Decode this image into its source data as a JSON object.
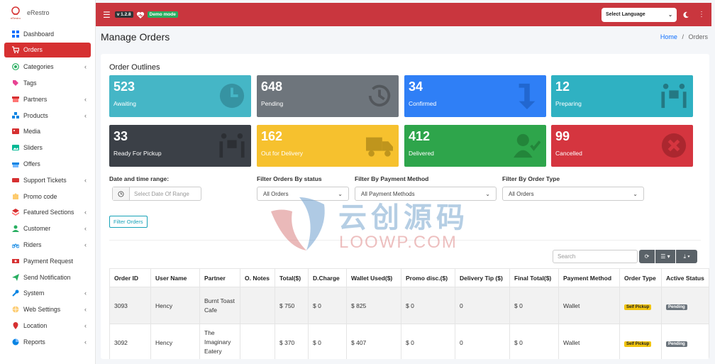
{
  "brand": {
    "name": "eRestro",
    "logo_text": "eRestro"
  },
  "sidebar": {
    "items": [
      {
        "label": "Dashboard",
        "icon": "grid-icon"
      },
      {
        "label": "Orders",
        "icon": "cart-icon",
        "active": true
      },
      {
        "label": "Categories",
        "icon": "target-icon",
        "has_children": true
      },
      {
        "label": "Tags",
        "icon": "tag-icon"
      },
      {
        "label": "Partners",
        "icon": "store-icon",
        "has_children": true
      },
      {
        "label": "Products",
        "icon": "cubes-icon",
        "has_children": true
      },
      {
        "label": "Media",
        "icon": "media-icon"
      },
      {
        "label": "Sliders",
        "icon": "image-icon"
      },
      {
        "label": "Offers",
        "icon": "gift-icon"
      },
      {
        "label": "Support Tickets",
        "icon": "ticket-icon",
        "has_children": true
      },
      {
        "label": "Promo code",
        "icon": "puzzle-icon"
      },
      {
        "label": "Featured Sections",
        "icon": "layers-icon",
        "has_children": true
      },
      {
        "label": "Customer",
        "icon": "user-icon",
        "has_children": true
      },
      {
        "label": "Riders",
        "icon": "motorcycle-icon",
        "has_children": true
      },
      {
        "label": "Payment Request",
        "icon": "money-icon"
      },
      {
        "label": "Send Notification",
        "icon": "paper-plane-icon"
      },
      {
        "label": "System",
        "icon": "wrench-icon",
        "has_children": true
      },
      {
        "label": "Web Settings",
        "icon": "globe-icon",
        "has_children": true
      },
      {
        "label": "Location",
        "icon": "map-icon",
        "has_children": true
      },
      {
        "label": "Reports",
        "icon": "chart-icon",
        "has_children": true
      }
    ]
  },
  "topbar": {
    "version": "v 1.2.8",
    "demo_label": "Demo mode",
    "language_select": "Select Language"
  },
  "page": {
    "title": "Manage Orders",
    "breadcrumb_home": "Home",
    "breadcrumb_sep": "/",
    "breadcrumb_current": "Orders"
  },
  "outline": {
    "title": "Order Outlines",
    "tiles": [
      {
        "count": "523",
        "label": "Awaiting",
        "color": "#45b6c6",
        "icon": "clock-icon"
      },
      {
        "count": "648",
        "label": "Pending",
        "color": "#6e757c",
        "icon": "history-icon"
      },
      {
        "count": "34",
        "label": "Confirmed",
        "color": "#2f7ff6",
        "icon": "arrow-down-icon"
      },
      {
        "count": "12",
        "label": "Preparing",
        "color": "#2fb1c2",
        "icon": "people-carry-icon"
      },
      {
        "count": "33",
        "label": "Ready For Pickup",
        "color": "#3b4047",
        "icon": "people-carry-icon"
      },
      {
        "count": "162",
        "label": "Out for Delivery",
        "color": "#f6c12e",
        "icon": "truck-icon"
      },
      {
        "count": "412",
        "label": "Delivered",
        "color": "#2ea54b",
        "icon": "user-check-icon"
      },
      {
        "count": "99",
        "label": "Cancelled",
        "color": "#d5353f",
        "icon": "times-circle-icon"
      }
    ]
  },
  "filters": {
    "date_label": "Date and time range:",
    "date_placeholder": "Select Date Of Range",
    "status_label": "Filter Orders By status",
    "status_value": "All Orders",
    "payment_label": "Filter By Payment Method",
    "payment_value": "All Payment Methods",
    "type_label": "Filter By Order Type",
    "type_value": "All Orders",
    "button": "Filter Orders"
  },
  "table": {
    "search_placeholder": "Search",
    "columns": [
      "Order ID",
      "User Name",
      "Partner",
      "O. Notes",
      "Total($)",
      "D.Charge",
      "Wallet Used($)",
      "Promo disc.($)",
      "Delivery Tip ($)",
      "Final Total($)",
      "Payment Method",
      "Order Type",
      "Active Status"
    ],
    "rows": [
      {
        "id": "3093",
        "user": "Hency",
        "partner": "Burnt Toast Cafe",
        "notes": "",
        "total": "$ 750",
        "dcharge": "$ 0",
        "wallet": "$ 825",
        "promo": "$ 0",
        "tip": "0",
        "final": "$ 0",
        "payment": "Wallet",
        "type": "Self Pickup",
        "status": "Pending"
      },
      {
        "id": "3092",
        "user": "Hency",
        "partner": "The Imaginary Eatery",
        "notes": "",
        "total": "$ 370",
        "dcharge": "$ 0",
        "wallet": "$ 407",
        "promo": "$ 0",
        "tip": "0",
        "final": "$ 0",
        "payment": "Wallet",
        "type": "Self Pickup",
        "status": "Pending"
      }
    ]
  },
  "watermark": {
    "cn": "云创源码",
    "en": "LOOWP.COM"
  }
}
